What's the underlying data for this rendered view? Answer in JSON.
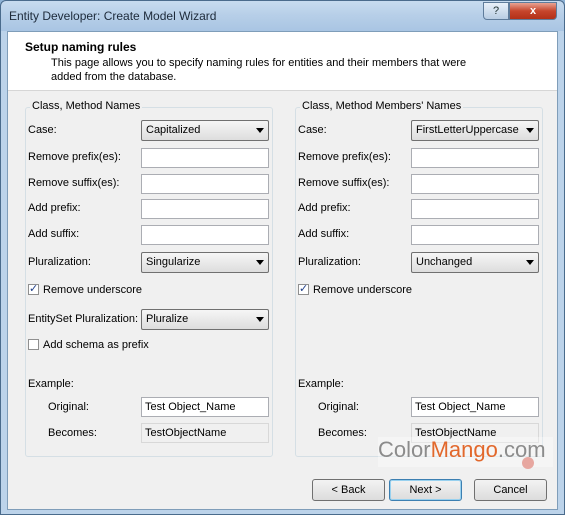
{
  "window": {
    "title": "Entity Developer: Create Model Wizard",
    "help_label": "?",
    "close_label": "x",
    "help_icon": "question-icon",
    "close_icon": "close-icon"
  },
  "header": {
    "title": "Setup naming rules",
    "description": "This page allows you to specify naming rules for entities and their members that were added from the database."
  },
  "left_group": {
    "legend": "Class, Method Names",
    "case_label": "Case:",
    "case_value": "Capitalized",
    "remove_prefix_label": "Remove prefix(es):",
    "remove_prefix_value": "",
    "remove_suffix_label": "Remove suffix(es):",
    "remove_suffix_value": "",
    "add_prefix_label": "Add prefix:",
    "add_prefix_value": "",
    "add_suffix_label": "Add suffix:",
    "add_suffix_value": "",
    "pluralization_label": "Pluralization:",
    "pluralization_value": "Singularize",
    "remove_underscore_label": "Remove underscore",
    "remove_underscore_checked": true,
    "entityset_label": "EntitySet Pluralization:",
    "entityset_value": "Pluralize",
    "add_schema_label": "Add schema as prefix",
    "add_schema_checked": false,
    "example_label": "Example:",
    "original_label": "Original:",
    "original_value": "Test Object_Name",
    "becomes_label": "Becomes:",
    "becomes_value": "TestObjectName"
  },
  "right_group": {
    "legend": "Class, Method Members' Names",
    "case_label": "Case:",
    "case_value": "FirstLetterUppercase",
    "remove_prefix_label": "Remove prefix(es):",
    "remove_prefix_value": "",
    "remove_suffix_label": "Remove suffix(es):",
    "remove_suffix_value": "",
    "add_prefix_label": "Add prefix:",
    "add_prefix_value": "",
    "add_suffix_label": "Add suffix:",
    "add_suffix_value": "",
    "pluralization_label": "Pluralization:",
    "pluralization_value": "Unchanged",
    "remove_underscore_label": "Remove underscore",
    "remove_underscore_checked": true,
    "example_label": "Example:",
    "original_label": "Original:",
    "original_value": "Test Object_Name",
    "becomes_label": "Becomes:",
    "becomes_value": "TestObjectName"
  },
  "buttons": {
    "back": "< Back",
    "next": "Next >",
    "cancel": "Cancel"
  },
  "watermark": {
    "part1": "Color",
    "part2": "Mango",
    "part3": ".com"
  },
  "colors": {
    "titlebar": "#b7cfe8",
    "close_button": "#c6452c",
    "dialog_background": "#f0f0f0",
    "watermark_accent": "#e2682c"
  }
}
